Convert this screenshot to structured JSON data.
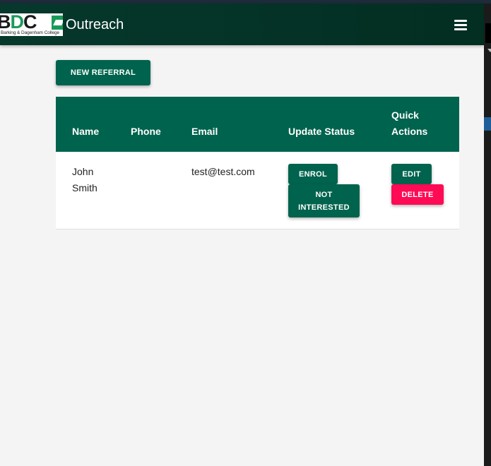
{
  "navbar": {
    "logo": {
      "letters_b": "B",
      "letters_d": "D",
      "letters_c": "C",
      "subtitle": "Barking & Dagenham College"
    },
    "title": "Outreach",
    "menu_icon": "hamburger-menu-icon"
  },
  "toolbar": {
    "new_referral_label": "NEW REFERRAL"
  },
  "table": {
    "headers": {
      "name": "Name",
      "phone": "Phone",
      "email": "Email",
      "update_status": "Update Status",
      "quick_actions": "Quick Actions"
    },
    "rows": [
      {
        "name": "John Smith",
        "phone": "",
        "email": "test@test.com",
        "status_actions": {
          "enrol": "ENROL",
          "not_interested": "NOT INTERESTED"
        },
        "quick_actions": {
          "edit": "EDIT",
          "delete": "DELETE"
        }
      }
    ]
  },
  "colors": {
    "primary": "#00634d",
    "navbar": "#032e22",
    "danger": "#ff0a55",
    "background": "#f4f4f4"
  }
}
